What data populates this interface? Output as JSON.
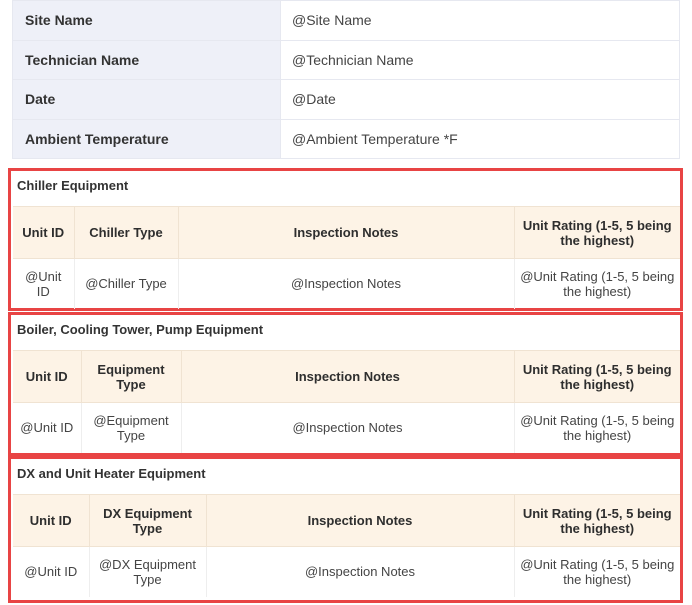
{
  "info": [
    {
      "label": "Site Name",
      "value": "@Site Name"
    },
    {
      "label": "Technician Name",
      "value": "@Technician Name"
    },
    {
      "label": "Date",
      "value": "@Date"
    },
    {
      "label": "Ambient Temperature",
      "value": "@Ambient Temperature *F"
    }
  ],
  "sections": [
    {
      "title": "Chiller Equipment",
      "headers": [
        "Unit ID",
        "Chiller Type",
        "Inspection Notes",
        "Unit Rating (1-5, 5 being the highest)"
      ],
      "row": [
        "@Unit ID",
        "@Chiller Type",
        "@Inspection Notes",
        "@Unit Rating (1-5, 5 being the highest)"
      ]
    },
    {
      "title": "Boiler, Cooling Tower, Pump Equipment",
      "headers": [
        "Unit ID",
        "Equipment Type",
        "Inspection Notes",
        "Unit Rating (1-5, 5 being the highest)"
      ],
      "row": [
        "@Unit ID",
        "@Equipment Type",
        "@Inspection Notes",
        "@Unit Rating (1-5, 5 being the highest)"
      ]
    },
    {
      "title": "DX and Unit Heater Equipment",
      "headers": [
        "Unit ID",
        "DX Equipment Type",
        "Inspection Notes",
        "Unit Rating (1-5, 5 being the highest)"
      ],
      "row": [
        "@Unit ID",
        "@DX Equipment Type",
        "@Inspection Notes",
        "@Unit Rating (1-5, 5 being the highest)"
      ]
    }
  ],
  "colors": {
    "highlight_border": "#e84444",
    "header_bg": "#fdf3e6",
    "label_bg": "#eef0f8"
  }
}
